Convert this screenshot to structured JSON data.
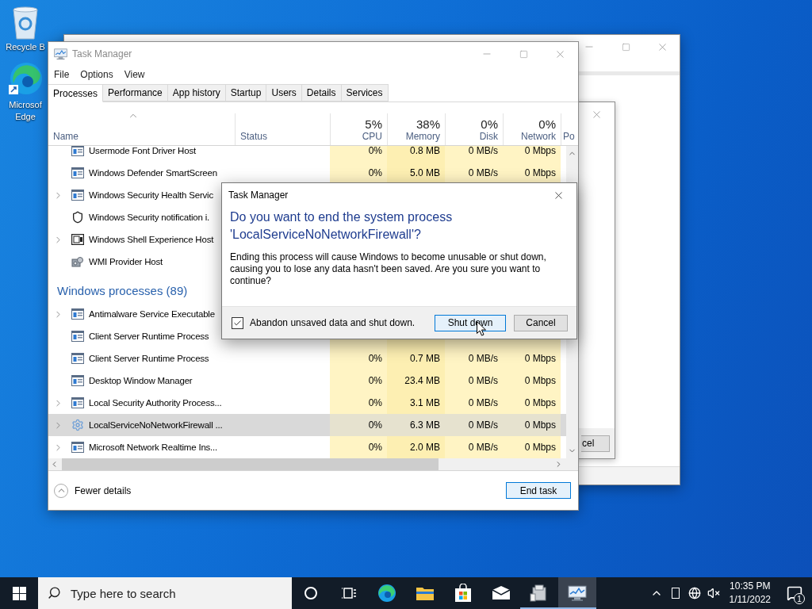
{
  "desktop_icons": [
    {
      "kind": "recycle_bin",
      "label": "Recycle B"
    },
    {
      "kind": "edge",
      "label": "Microsof\nEdge"
    }
  ],
  "back_window": {
    "dialog_button": "cel"
  },
  "task_manager": {
    "title": "Task Manager",
    "menu": [
      "File",
      "Options",
      "View"
    ],
    "tabs": [
      {
        "label": "Processes",
        "selected": true
      },
      {
        "label": "Performance",
        "selected": false
      },
      {
        "label": "App history",
        "selected": false
      },
      {
        "label": "Startup",
        "selected": false
      },
      {
        "label": "Users",
        "selected": false
      },
      {
        "label": "Details",
        "selected": false
      },
      {
        "label": "Services",
        "selected": false
      }
    ],
    "columns": [
      {
        "label": "Name"
      },
      {
        "label": "Status"
      },
      {
        "label": "CPU",
        "percent": "5%"
      },
      {
        "label": "Memory",
        "percent": "38%"
      },
      {
        "label": "Disk",
        "percent": "0%"
      },
      {
        "label": "Network",
        "percent": "0%"
      },
      {
        "label": "Po"
      }
    ],
    "rows": [
      {
        "kind": "app",
        "name": "Usermode Font Driver Host",
        "expandable": false,
        "selected": false,
        "cpu": "0%",
        "memory": "0.8 MB",
        "disk": "0 MB/s",
        "network": "0 Mbps"
      },
      {
        "kind": "app",
        "name": "Windows Defender SmartScreen",
        "expandable": false,
        "selected": false,
        "cpu": "0%",
        "memory": "5.0 MB",
        "disk": "0 MB/s",
        "network": "0 Mbps"
      },
      {
        "kind": "app",
        "name": "Windows Security Health Servic",
        "expandable": true,
        "selected": false
      },
      {
        "kind": "shield",
        "name": "Windows Security notification i.",
        "expandable": false,
        "selected": false
      },
      {
        "kind": "shell",
        "name": "Windows Shell Experience Host",
        "expandable": true,
        "selected": false
      },
      {
        "kind": "wmi",
        "name": "WMI Provider Host",
        "expandable": false,
        "selected": false
      },
      {
        "kind": "group",
        "name": "Windows processes (89)"
      },
      {
        "kind": "app",
        "name": "Antimalware Service Executable",
        "expandable": true,
        "selected": false
      },
      {
        "kind": "app",
        "name": "Client Server Runtime Process",
        "expandable": false,
        "selected": false
      },
      {
        "kind": "app",
        "name": "Client Server Runtime Process",
        "expandable": false,
        "selected": false,
        "cpu": "0%",
        "memory": "0.7 MB",
        "disk": "0 MB/s",
        "network": "0 Mbps"
      },
      {
        "kind": "app",
        "name": "Desktop Window Manager",
        "expandable": false,
        "selected": false,
        "cpu": "0%",
        "memory": "23.4 MB",
        "disk": "0 MB/s",
        "network": "0 Mbps"
      },
      {
        "kind": "app",
        "name": "Local Security Authority Process...",
        "expandable": true,
        "selected": false,
        "cpu": "0%",
        "memory": "3.1 MB",
        "disk": "0 MB/s",
        "network": "0 Mbps"
      },
      {
        "kind": "gear",
        "name": "LocalServiceNoNetworkFirewall ...",
        "expandable": true,
        "selected": true,
        "cpu": "0%",
        "memory": "6.3 MB",
        "disk": "0 MB/s",
        "network": "0 Mbps"
      },
      {
        "kind": "app",
        "name": "Microsoft Network Realtime Ins...",
        "expandable": true,
        "selected": false,
        "cpu": "0%",
        "memory": "2.0 MB",
        "disk": "0 MB/s",
        "network": "0 Mbps"
      }
    ],
    "fewer_details": "Fewer details",
    "end_task": "End task"
  },
  "dialog": {
    "title": "Task Manager",
    "heading": "Do you want to end the system process 'LocalServiceNoNetworkFirewall'?",
    "message": "Ending this process will cause Windows to become unusable or shut down, causing you to lose any data hasn't been saved. Are you sure you want to continue?",
    "checkbox": {
      "label": "Abandon unsaved data and shut down.",
      "checked": true
    },
    "buttons": [
      {
        "label": "Shut down",
        "focused": true
      },
      {
        "label": "Cancel",
        "focused": false
      }
    ]
  },
  "taskbar": {
    "search_placeholder": "Type here to search",
    "apps": [
      {
        "kind": "cortana",
        "running": false,
        "active": false
      },
      {
        "kind": "task_view",
        "running": false,
        "active": false
      },
      {
        "kind": "edge",
        "running": false,
        "active": false
      },
      {
        "kind": "explorer",
        "running": false,
        "active": false
      },
      {
        "kind": "store",
        "running": false,
        "active": false
      },
      {
        "kind": "mail",
        "running": false,
        "active": false
      },
      {
        "kind": "app",
        "running": true,
        "active": false
      },
      {
        "kind": "task_manager",
        "running": true,
        "active": true
      }
    ],
    "time": "10:35 PM",
    "date": "1/11/2022",
    "notifications": "1"
  }
}
